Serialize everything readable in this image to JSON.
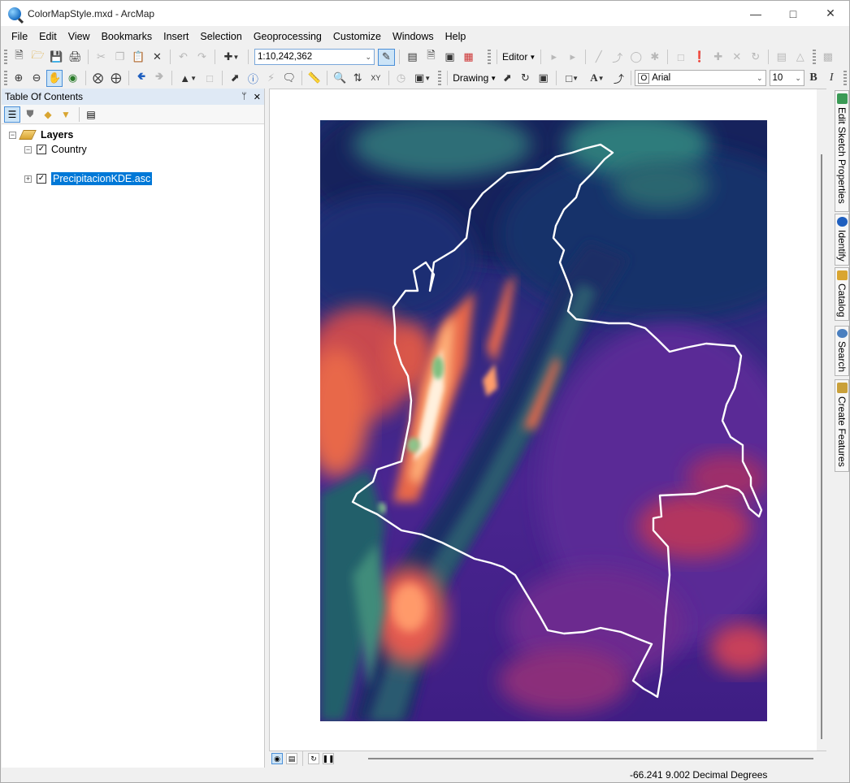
{
  "window": {
    "title": "ColorMapStyle.mxd - ArcMap"
  },
  "menu": [
    "File",
    "Edit",
    "View",
    "Bookmarks",
    "Insert",
    "Selection",
    "Geoprocessing",
    "Customize",
    "Windows",
    "Help"
  ],
  "toolbar": {
    "scale": "1:10,242,362",
    "editor_label": "Editor",
    "drawing_label": "Drawing",
    "font_name": "Arial",
    "font_size": "10",
    "bold": "B",
    "italic": "I"
  },
  "toc": {
    "title": "Table Of Contents",
    "pin": "ᛘ",
    "close": "✕",
    "root": "Layers",
    "layers": [
      {
        "name": "Country",
        "checked": true
      },
      {
        "name": "PrecipitacionKDE.asc",
        "checked": true,
        "selected": true
      }
    ]
  },
  "dock_tabs": [
    "Edit Sketch Properties",
    "Identify",
    "Catalog",
    "Search",
    "Create Features"
  ],
  "status": {
    "coordinates": "-66.241  9.002 Decimal Degrees"
  }
}
